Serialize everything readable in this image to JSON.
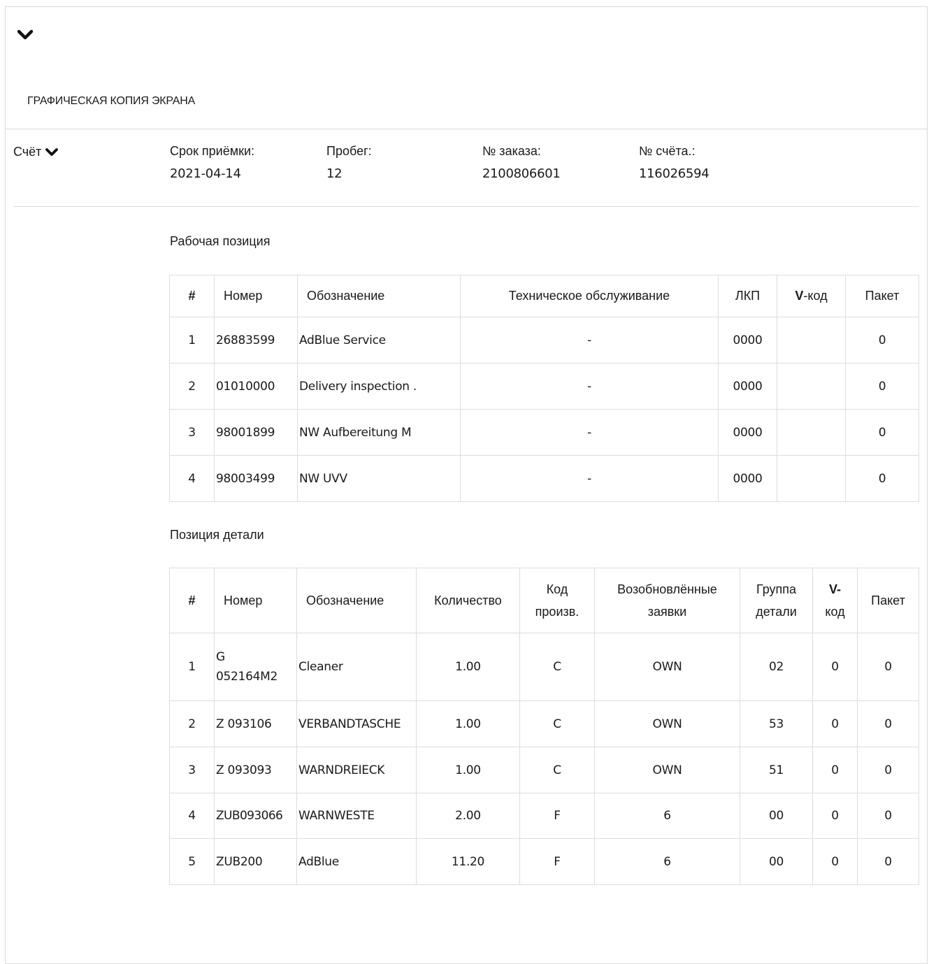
{
  "header": {
    "screen_copy_title": "ГРАФИЧЕСКАЯ КОПИЯ ЭКРАНА"
  },
  "account": {
    "label": "Счёт"
  },
  "info": {
    "acceptance_date": {
      "label": "Срок приёмки:",
      "value": "2021-04-14"
    },
    "mileage": {
      "label": "Пробег:",
      "value": "12"
    },
    "order_number": {
      "label": "№ заказа:",
      "value": "2100806601"
    },
    "invoice_number": {
      "label": "№ счёта.:",
      "value": "116026594"
    }
  },
  "work_positions": {
    "title": "Рабочая позиция",
    "headers": {
      "num": "#",
      "number": "Номер",
      "designation": "Обозначение",
      "maintenance": "Техническое обслуживание",
      "lkp": "ЛКП",
      "v_bold": "V",
      "v_rest": "-код",
      "package": "Пакет"
    },
    "rows": [
      {
        "num": "1",
        "number": "26883599",
        "designation": "AdBlue Service",
        "maintenance": "-",
        "lkp": "0000",
        "vcode": "",
        "package": "0"
      },
      {
        "num": "2",
        "number": "01010000",
        "designation": "Delivery inspection .",
        "maintenance": "-",
        "lkp": "0000",
        "vcode": "",
        "package": "0"
      },
      {
        "num": "3",
        "number": "98001899",
        "designation": "NW Aufbereitung M",
        "maintenance": "-",
        "lkp": "0000",
        "vcode": "",
        "package": "0"
      },
      {
        "num": "4",
        "number": "98003499",
        "designation": "NW UVV",
        "maintenance": "-",
        "lkp": "0000",
        "vcode": "",
        "package": "0"
      }
    ]
  },
  "part_positions": {
    "title": "Позиция детали",
    "headers": {
      "num": "#",
      "number": "Номер",
      "designation": "Обозначение",
      "quantity": "Количество",
      "code_l1": "Код",
      "code_l2": "произв.",
      "renewed_l1": "Возобновлённые",
      "renewed_l2": "заявки",
      "group_l1": "Группа",
      "group_l2": "детали",
      "v_bold": "V-",
      "v_rest": "код",
      "package": "Пакет"
    },
    "rows": [
      {
        "num": "1",
        "number_l1": "G",
        "number_l2": "052164M2",
        "designation": "Cleaner",
        "quantity": "1.00",
        "code": "C",
        "renewed": "OWN",
        "group": "02",
        "vcode": "0",
        "package": "0"
      },
      {
        "num": "2",
        "number_l1": "Z 093106",
        "number_l2": "",
        "designation": "VERBANDTASCHE",
        "quantity": "1.00",
        "code": "C",
        "renewed": "OWN",
        "group": "53",
        "vcode": "0",
        "package": "0"
      },
      {
        "num": "3",
        "number_l1": "Z 093093",
        "number_l2": "",
        "designation": "WARNDREIECK",
        "quantity": "1.00",
        "code": "C",
        "renewed": "OWN",
        "group": "51",
        "vcode": "0",
        "package": "0"
      },
      {
        "num": "4",
        "number_l1": "ZUB093066",
        "number_l2": "",
        "designation": "WARNWESTE",
        "quantity": "2.00",
        "code": "F",
        "renewed": "6",
        "group": "00",
        "vcode": "0",
        "package": "0"
      },
      {
        "num": "5",
        "number_l1": "ZUB200",
        "number_l2": "",
        "designation": "AdBlue",
        "quantity": "11.20",
        "code": "F",
        "renewed": "6",
        "group": "00",
        "vcode": "0",
        "package": "0"
      }
    ]
  }
}
